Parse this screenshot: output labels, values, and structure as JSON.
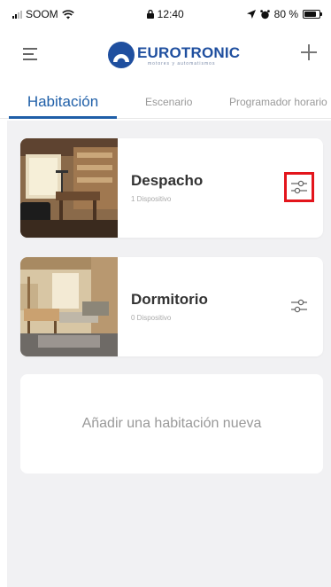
{
  "status_bar": {
    "carrier": "SOOM",
    "time": "12:40",
    "battery": "80 %",
    "battery_level": 0.8
  },
  "header": {
    "logo_text": "EUROTRONIC",
    "logo_subtitle": "motores y automatismos",
    "menu_icon": "hamburger-icon",
    "add_icon": "plus-icon"
  },
  "tabs": [
    {
      "label": "Habitación",
      "active": true
    },
    {
      "label": "Escenario",
      "active": false
    },
    {
      "label": "Programador horario",
      "active": false
    }
  ],
  "rooms": [
    {
      "name": "Despacho",
      "devices": "1 Dispositivo",
      "settings_icon": "sliders-icon"
    },
    {
      "name": "Dormitorio",
      "devices": "0 Dispositivo",
      "settings_icon": "sliders-icon"
    }
  ],
  "add_room_label": "Añadir una habitación nueva",
  "colors": {
    "accent": "#1f5fa8",
    "highlight": "#e3151c",
    "background": "#f1f1f3"
  }
}
